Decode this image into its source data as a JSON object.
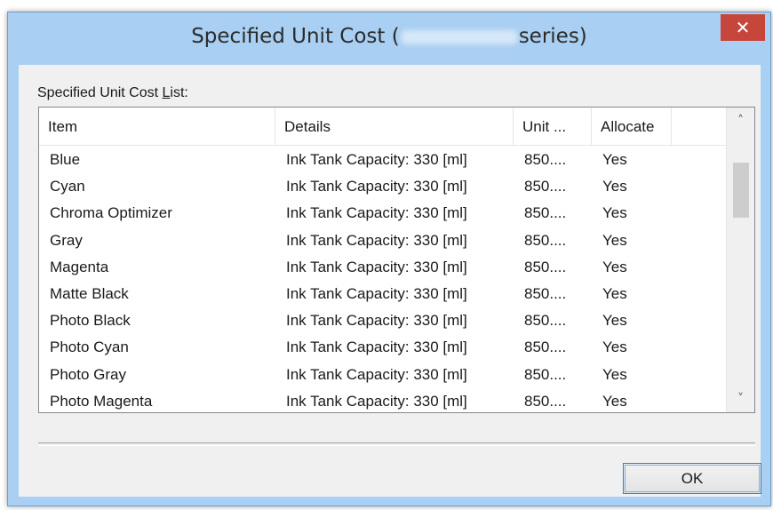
{
  "window": {
    "title_prefix": "Specified Unit Cost (",
    "title_suffix": "series)",
    "close_glyph": "✕"
  },
  "list_label": {
    "before": "Specified Unit Cost ",
    "accel": "L",
    "after": "ist:"
  },
  "columns": [
    "Item",
    "Details",
    "Unit ...",
    "Allocate"
  ],
  "rows": [
    {
      "item": "Blue",
      "details": "Ink Tank Capacity: 330 [ml]",
      "unit": "850....",
      "allocate": "Yes"
    },
    {
      "item": "Cyan",
      "details": "Ink Tank Capacity: 330 [ml]",
      "unit": "850....",
      "allocate": "Yes"
    },
    {
      "item": "Chroma Optimizer",
      "details": "Ink Tank Capacity: 330 [ml]",
      "unit": "850....",
      "allocate": "Yes"
    },
    {
      "item": "Gray",
      "details": "Ink Tank Capacity: 330 [ml]",
      "unit": "850....",
      "allocate": "Yes"
    },
    {
      "item": "Magenta",
      "details": "Ink Tank Capacity: 330 [ml]",
      "unit": "850....",
      "allocate": "Yes"
    },
    {
      "item": "Matte Black",
      "details": "Ink Tank Capacity: 330 [ml]",
      "unit": "850....",
      "allocate": "Yes"
    },
    {
      "item": "Photo Black",
      "details": "Ink Tank Capacity: 330 [ml]",
      "unit": "850....",
      "allocate": "Yes"
    },
    {
      "item": "Photo Cyan",
      "details": "Ink Tank Capacity: 330 [ml]",
      "unit": "850....",
      "allocate": "Yes"
    },
    {
      "item": "Photo Gray",
      "details": "Ink Tank Capacity: 330 [ml]",
      "unit": "850....",
      "allocate": "Yes"
    },
    {
      "item": "Photo Magenta",
      "details": "Ink Tank Capacity: 330 [ml]",
      "unit": "850....",
      "allocate": "Yes"
    }
  ],
  "scrollbar": {
    "up_glyph": "˄",
    "down_glyph": "˅"
  },
  "buttons": {
    "ok": "OK"
  },
  "colors": {
    "title_bar": "#a9cff2",
    "close_button": "#c7463b",
    "client": "#f0f0f0",
    "ok_border": "#3c7fb1"
  }
}
